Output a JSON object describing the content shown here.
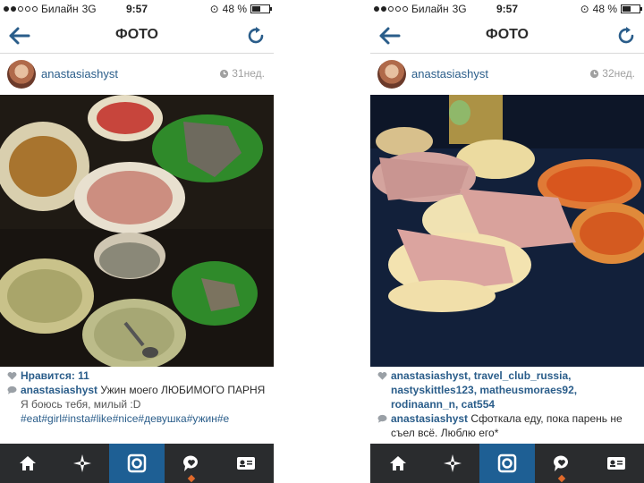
{
  "screens": [
    {
      "status": {
        "carrier": "Билайн",
        "network": "3G",
        "time": "9:57",
        "battery": "48 %",
        "battery_level": 0.48
      },
      "nav": {
        "title": "ФОТО"
      },
      "post": {
        "username": "anastasiashyst",
        "time_ago": "31нед.",
        "likes": "Нравится: 11",
        "caption_user": "anastasiashyst",
        "caption_text": " Ужин моего ЛЮБИМОГО ПАРНЯ",
        "caption_line2": "Я боюсь тебя, милый :D",
        "hashtags": "#eat#girl#insta#like#nice#девушка#ужин#е"
      }
    },
    {
      "status": {
        "carrier": "Билайн",
        "network": "3G",
        "time": "9:57",
        "battery": "48 %",
        "battery_level": 0.48
      },
      "nav": {
        "title": "ФОТО"
      },
      "post": {
        "username": "anastasiashyst",
        "time_ago": "32нед.",
        "likes_users": "anastasiashyst, travel_club_russia, nastyskittles123, matheusmoraes92, rodinaann_n, cat554",
        "caption_user": "anastasiashyst",
        "caption_text": " Сфоткала еду, пока парень не съел всё. Люблю его*"
      }
    }
  ],
  "tabs": [
    "home-icon",
    "explore-icon",
    "camera-icon",
    "activity-icon",
    "profile-icon"
  ],
  "colors": {
    "link": "#2a5d8a",
    "tab_bar": "#2a2c2e",
    "tab_active": "#1e5f94",
    "notification": "#e06a2b"
  }
}
